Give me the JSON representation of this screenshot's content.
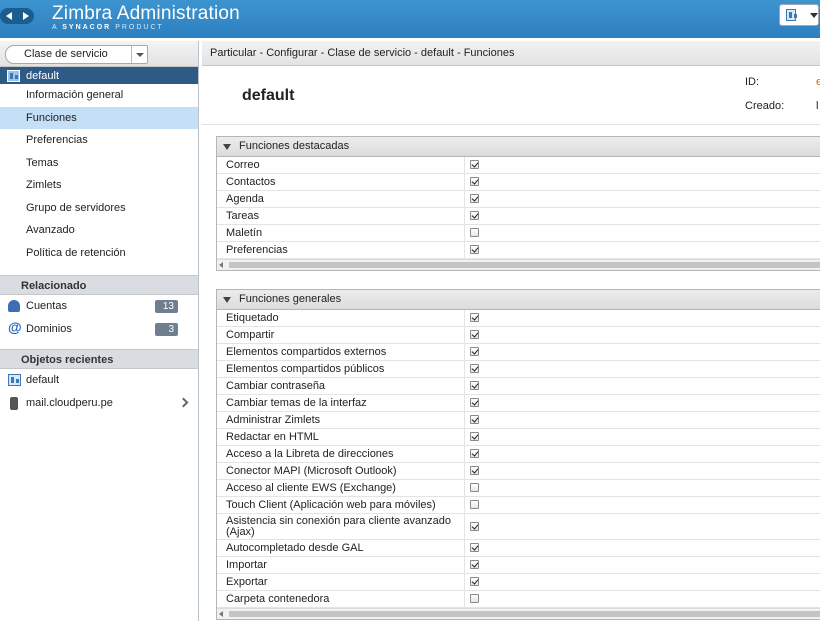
{
  "app": {
    "title": "Zimbra Administration",
    "subtitle_prefix": "A ",
    "subtitle_brand": "SYNACOR",
    "subtitle_suffix": " PRODUCT"
  },
  "left": {
    "selector_value": "Clase de servicio",
    "tree_root": "default",
    "nav_items": [
      {
        "label": "Información general",
        "active": false
      },
      {
        "label": "Funciones",
        "active": true
      },
      {
        "label": "Preferencias",
        "active": false
      },
      {
        "label": "Temas",
        "active": false
      },
      {
        "label": "Zimlets",
        "active": false
      },
      {
        "label": "Grupo de servidores",
        "active": false
      },
      {
        "label": "Avanzado",
        "active": false
      },
      {
        "label": "Política de retención",
        "active": false
      }
    ],
    "related_title": "Relacionado",
    "related": [
      {
        "label": "Cuentas",
        "count": "13",
        "icon": "user-icon"
      },
      {
        "label": "Dominios",
        "count": "3",
        "icon": "at-icon"
      }
    ],
    "recent_title": "Objetos recientes",
    "recent": [
      {
        "label": "default",
        "icon": "cos-icon"
      },
      {
        "label": "mail.cloudperu.pe",
        "icon": "server-icon"
      }
    ]
  },
  "breadcrumb": "Particular - Configurar - Clase de servicio - default - Funciones",
  "header": {
    "name": "default",
    "id_label": "ID:",
    "id_value": "e",
    "created_label": "Creado:",
    "created_value": "l"
  },
  "featured": {
    "title": "Funciones destacadas",
    "rows": [
      {
        "label": "Correo",
        "checked": true
      },
      {
        "label": "Contactos",
        "checked": true
      },
      {
        "label": "Agenda",
        "checked": true
      },
      {
        "label": "Tareas",
        "checked": true
      },
      {
        "label": "Maletín",
        "checked": false
      },
      {
        "label": "Preferencias",
        "checked": true
      }
    ]
  },
  "general": {
    "title": "Funciones generales",
    "rows": [
      {
        "label": "Etiquetado",
        "checked": true
      },
      {
        "label": "Compartir",
        "checked": true
      },
      {
        "label": "Elementos compartidos externos",
        "checked": true
      },
      {
        "label": "Elementos compartidos públicos",
        "checked": true
      },
      {
        "label": "Cambiar contraseña",
        "checked": true
      },
      {
        "label": "Cambiar temas de la interfaz",
        "checked": true
      },
      {
        "label": "Administrar Zimlets",
        "checked": true
      },
      {
        "label": "Redactar en HTML",
        "checked": true
      },
      {
        "label": "Acceso a la Libreta de direcciones",
        "checked": true
      },
      {
        "label": "Conector MAPI (Microsoft Outlook)",
        "checked": true
      },
      {
        "label": "Acceso al cliente EWS (Exchange)",
        "checked": false
      },
      {
        "label": "Touch Client (Aplicación web para móviles)",
        "checked": false
      },
      {
        "label": "Asistencia sin conexión para cliente avanzado (Ajax)",
        "checked": true,
        "tall": true
      },
      {
        "label": "Autocompletado desde GAL",
        "checked": true
      },
      {
        "label": "Importar",
        "checked": true
      },
      {
        "label": "Exportar",
        "checked": true
      },
      {
        "label": "Carpeta contenedora",
        "checked": false
      }
    ]
  }
}
